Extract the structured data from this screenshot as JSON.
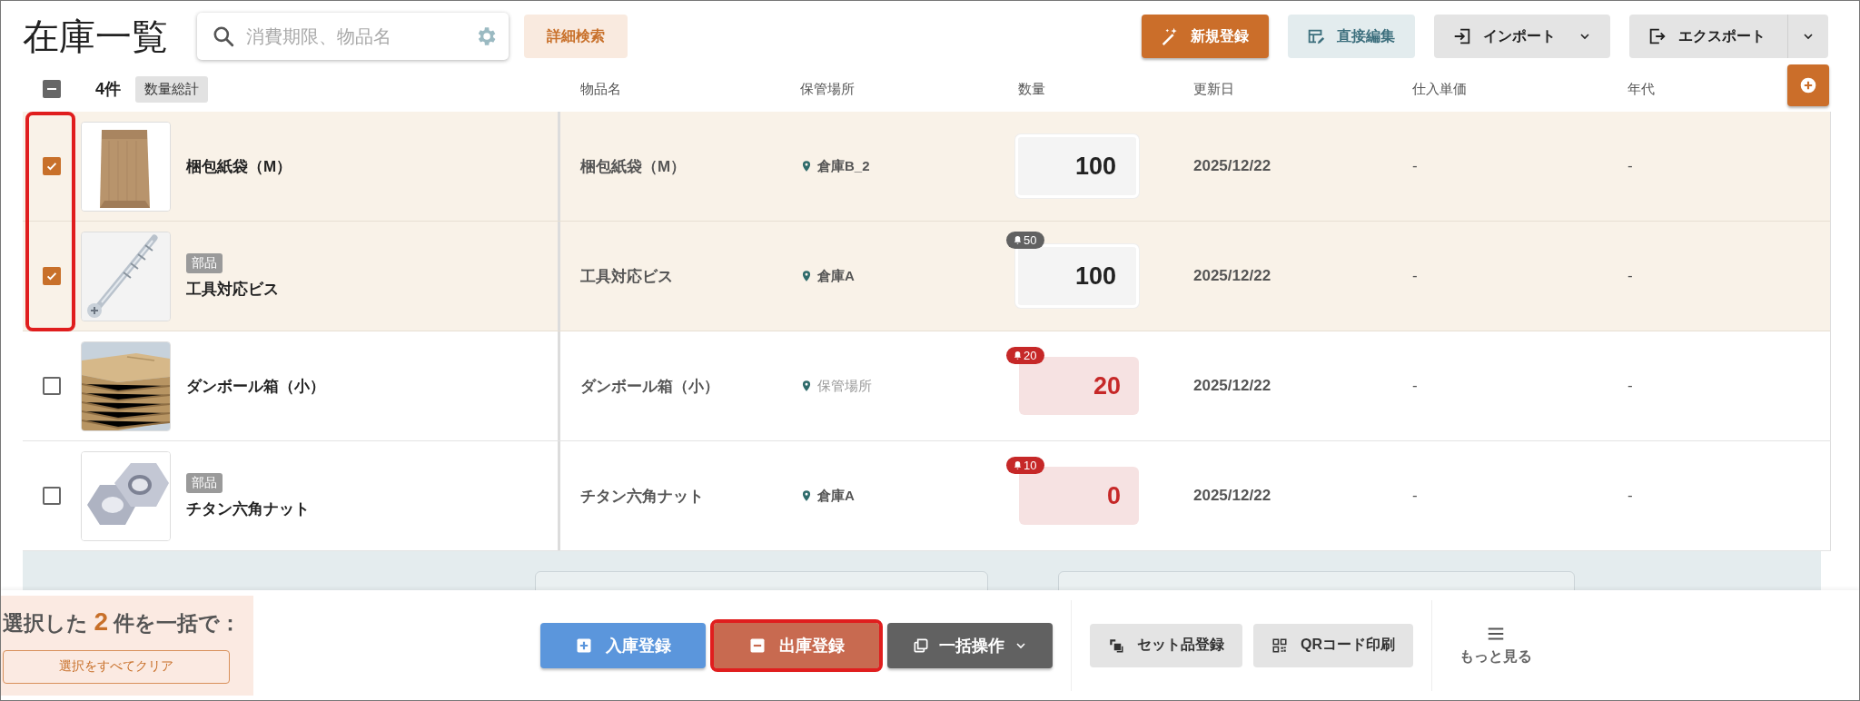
{
  "title": "在庫一覧",
  "search": {
    "placeholder": "消費期限、物品名"
  },
  "advanced_search": "詳細検索",
  "toolbar": [
    {
      "label": "新規登録",
      "kind": "primary"
    },
    {
      "label": "直接編集",
      "kind": "soft"
    },
    {
      "label": "インポート",
      "kind": "menu"
    },
    {
      "label": "エクスポート",
      "kind": "split"
    }
  ],
  "list_header": {
    "select_all": {
      "indeterminate": true
    },
    "count": "4件",
    "total_chip": "数量総計",
    "columns": [
      "物品名",
      "保管場所",
      "数量",
      "更新日",
      "仕入単価",
      "年代"
    ]
  },
  "rows": [
    {
      "selected": true,
      "name": "梱包紙袋（M）",
      "item_name": "梱包紙袋（M）",
      "location": {
        "value": "倉庫B_2"
      },
      "quantity": {
        "value": "100",
        "low": false
      },
      "updated": "2025/12/22",
      "unit_price": "-",
      "era": "-"
    },
    {
      "selected": true,
      "tag": "部品",
      "name": "工具対応ビス",
      "item_name": "工具対応ビス",
      "location": {
        "value": "倉庫A"
      },
      "quantity": {
        "value": "100",
        "low": false,
        "alert": "50"
      },
      "updated": "2025/12/22",
      "unit_price": "-",
      "era": "-"
    },
    {
      "selected": false,
      "name": "ダンボール箱（小）",
      "item_name": "ダンボール箱（小）",
      "location": {
        "placeholder": "保管場所"
      },
      "quantity": {
        "value": "20",
        "low": true,
        "alert": "20"
      },
      "updated": "2025/12/22",
      "unit_price": "-",
      "era": "-"
    },
    {
      "selected": false,
      "tag": "部品",
      "name": "チタン六角ナット",
      "item_name": "チタン六角ナット",
      "location": {
        "value": "倉庫A"
      },
      "quantity": {
        "value": "0",
        "low": true,
        "alert": "10"
      },
      "updated": "2025/12/22",
      "unit_price": "-",
      "era": "-"
    }
  ],
  "annotations": {
    "frame_selected_checkboxes": true
  },
  "bulk_bar": {
    "count_prefix": "選択した",
    "count": "2",
    "count_suffix": "件を一括で：",
    "clear": "選択をすべてクリア",
    "actions": [
      {
        "label": "入庫登録",
        "kind": "in",
        "highlighted": false
      },
      {
        "label": "出庫登録",
        "kind": "out",
        "highlighted": true
      },
      {
        "label": "一括操作",
        "kind": "menu",
        "highlighted": false
      }
    ],
    "secondary": [
      {
        "label": "セット品登録",
        "kind": "set"
      },
      {
        "label": "QRコード印刷",
        "kind": "qr"
      }
    ],
    "more": "もっと見る"
  }
}
